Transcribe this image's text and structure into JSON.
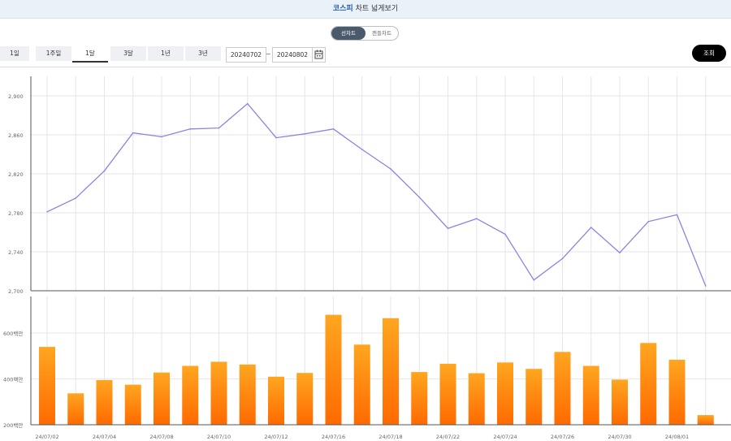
{
  "header": {
    "title_highlight": "코스피",
    "title_rest": " 차트 넓게보기"
  },
  "toggle": {
    "left_label": "선차트",
    "right_label": "캔들차트",
    "selected": "선차트"
  },
  "periods": [
    {
      "label": "1일"
    },
    {
      "label": "1주일"
    },
    {
      "label": "1달"
    },
    {
      "label": "3달"
    },
    {
      "label": "1년"
    },
    {
      "label": "3년"
    }
  ],
  "selected_period": "1달",
  "date_range": {
    "start": "20240702",
    "separator": "~",
    "end": "20240802"
  },
  "search_label": "조회",
  "chart_data": [
    {
      "type": "line",
      "title": "",
      "x": [
        "24/07/02",
        "24/07/03",
        "24/07/04",
        "24/07/05",
        "24/07/08",
        "24/07/09",
        "24/07/10",
        "24/07/11",
        "24/07/12",
        "24/07/15",
        "24/07/16",
        "24/07/17",
        "24/07/18",
        "24/07/19",
        "24/07/22",
        "24/07/23",
        "24/07/24",
        "24/07/25",
        "24/07/26",
        "24/07/29",
        "24/07/30",
        "24/07/31",
        "24/08/01",
        "24/08/02"
      ],
      "values": [
        2781,
        2795,
        2823,
        2862,
        2858,
        2866,
        2867,
        2892,
        2857,
        2861,
        2866,
        2845,
        2825,
        2796,
        2764,
        2774,
        2758,
        2711,
        2733,
        2765,
        2739,
        2771,
        2778,
        2705
      ],
      "yticks": [
        "2,700",
        "2,740",
        "2,780",
        "2,820",
        "2,860",
        "2,900"
      ],
      "ylim": [
        2700,
        2920
      ],
      "grid": true,
      "color": "#8a84e0"
    },
    {
      "type": "bar",
      "title": "",
      "x": [
        "24/07/02",
        "24/07/03",
        "24/07/04",
        "24/07/05",
        "24/07/08",
        "24/07/09",
        "24/07/10",
        "24/07/11",
        "24/07/12",
        "24/07/15",
        "24/07/16",
        "24/07/17",
        "24/07/18",
        "24/07/19",
        "24/07/22",
        "24/07/23",
        "24/07/24",
        "24/07/25",
        "24/07/26",
        "24/07/29",
        "24/07/30",
        "24/07/31",
        "24/08/01",
        "24/08/02"
      ],
      "values": [
        540,
        337,
        395,
        375,
        428,
        457,
        475,
        463,
        410,
        426,
        680,
        550,
        665,
        430,
        466,
        425,
        472,
        444,
        518,
        457,
        397,
        557,
        484,
        242
      ],
      "unit": "백만",
      "yticks": [
        "200백만",
        "400백만",
        "600백만"
      ],
      "ylim": [
        200,
        760
      ],
      "xtick_labels": [
        "24/07/02",
        "24/07/04",
        "24/07/08",
        "24/07/10",
        "24/07/12",
        "24/07/16",
        "24/07/18",
        "24/07/22",
        "24/07/24",
        "24/07/26",
        "24/07/30",
        "24/08/01"
      ],
      "grid": true,
      "colors": [
        "#ffa620",
        "#ff6a00"
      ]
    }
  ]
}
